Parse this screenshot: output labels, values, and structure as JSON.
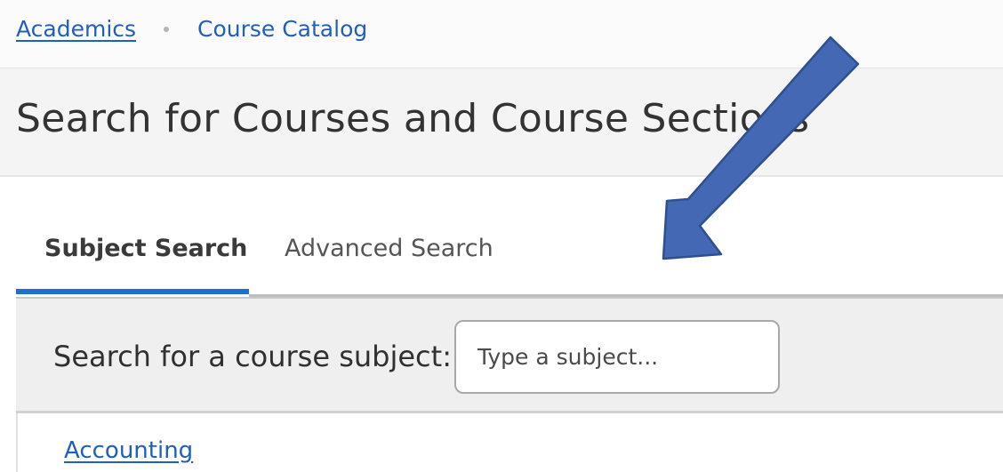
{
  "breadcrumb": {
    "items": [
      {
        "label": "Academics"
      },
      {
        "label": "Course Catalog"
      }
    ]
  },
  "page": {
    "title": "Search for Courses and Course Sections"
  },
  "tabs": [
    {
      "label": "Subject Search",
      "active": true
    },
    {
      "label": "Advanced Search",
      "active": false
    }
  ],
  "search": {
    "label": "Search for a course subject:",
    "placeholder": "Type a subject...",
    "value": ""
  },
  "subjects": [
    {
      "label": "Accounting"
    }
  ],
  "annotation": {
    "type": "arrow",
    "color": "#4468b4",
    "outline": "#2f4f8f",
    "points_to": "search-input"
  },
  "colors": {
    "link": "#1f5fc2",
    "accent": "#1f6fd1"
  }
}
